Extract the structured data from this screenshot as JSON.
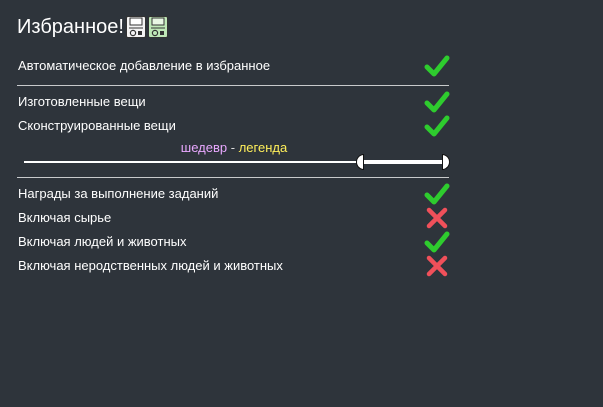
{
  "header": {
    "title": "Избранное!",
    "icons": [
      "save-icon",
      "save-as-icon"
    ]
  },
  "rows": [
    {
      "label": "Автоматическое добавление в избранное",
      "enabled": true
    },
    {
      "label": "Изготовленные вещи",
      "enabled": true
    },
    {
      "label": "Сконструированные вещи",
      "enabled": true
    },
    {
      "label": "Награды за выполнение заданий",
      "enabled": true
    },
    {
      "label": "Включая сырье",
      "enabled": false
    },
    {
      "label": "Включая людей и животных",
      "enabled": true
    },
    {
      "label": "Включая неродственных людей и животных",
      "enabled": false
    }
  ],
  "quality_range": {
    "low_label": "шедевр",
    "separator": "-",
    "high_label": "легенда",
    "low_value": 0.81,
    "high_value": 1.0
  },
  "colors": {
    "background": "#2e343b",
    "check": "#2ecc2e",
    "cross": "#f0505a",
    "low_quality": "#e9a8ff",
    "high_quality": "#ffef5a"
  }
}
